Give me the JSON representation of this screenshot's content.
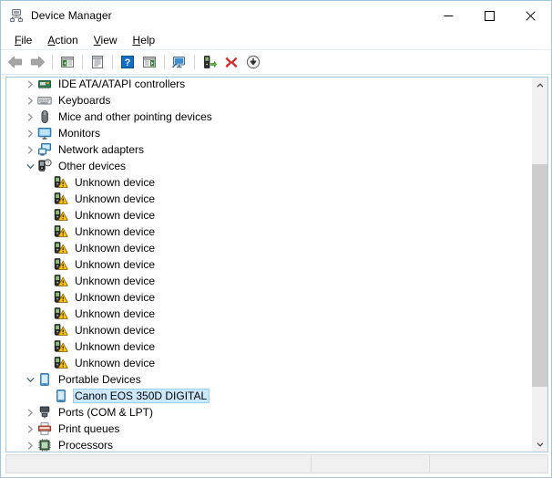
{
  "window": {
    "title": "Device Manager",
    "icon": "device-manager-icon"
  },
  "caption": {
    "minimize_label": "—",
    "maximize_label": "☐",
    "close_label": "✕"
  },
  "menubar": {
    "items": [
      {
        "label": "File",
        "accel": "F"
      },
      {
        "label": "Action",
        "accel": "A"
      },
      {
        "label": "View",
        "accel": "V"
      },
      {
        "label": "Help",
        "accel": "H"
      }
    ]
  },
  "toolbar": {
    "buttons": [
      {
        "name": "back-icon",
        "tooltip": "Back"
      },
      {
        "name": "forward-icon",
        "tooltip": "Forward"
      },
      {
        "name": "separator-1",
        "tooltip": ""
      },
      {
        "name": "show-hide-console-tree-icon",
        "tooltip": "Show/Hide Console Tree"
      },
      {
        "name": "separator-2",
        "tooltip": ""
      },
      {
        "name": "properties-icon",
        "tooltip": "Properties"
      },
      {
        "name": "separator-3",
        "tooltip": ""
      },
      {
        "name": "help-icon",
        "tooltip": "Help"
      },
      {
        "name": "show-hide-action-pane-icon",
        "tooltip": "Show/Hide Action Pane"
      },
      {
        "name": "separator-4",
        "tooltip": ""
      },
      {
        "name": "scan-for-hardware-changes-icon",
        "tooltip": "Scan for hardware changes"
      },
      {
        "name": "separator-5",
        "tooltip": ""
      },
      {
        "name": "update-driver-icon",
        "tooltip": "Update Driver Software"
      },
      {
        "name": "uninstall-device-icon",
        "tooltip": "Uninstall"
      },
      {
        "name": "disable-device-icon",
        "tooltip": "Disable"
      }
    ]
  },
  "tree": {
    "rows": [
      {
        "label": "IDE ATA/ATAPI controllers",
        "icon": "ide-controller-icon",
        "indent": 1,
        "twisty": "collapsed",
        "selected": false
      },
      {
        "label": "Keyboards",
        "icon": "keyboard-icon",
        "indent": 1,
        "twisty": "collapsed",
        "selected": false
      },
      {
        "label": "Mice and other pointing devices",
        "icon": "mouse-icon",
        "indent": 1,
        "twisty": "collapsed",
        "selected": false
      },
      {
        "label": "Monitors",
        "icon": "monitor-icon",
        "indent": 1,
        "twisty": "collapsed",
        "selected": false
      },
      {
        "label": "Network adapters",
        "icon": "network-adapter-icon",
        "indent": 1,
        "twisty": "collapsed",
        "selected": false
      },
      {
        "label": "Other devices",
        "icon": "other-devices-icon",
        "indent": 1,
        "twisty": "expanded",
        "selected": false
      },
      {
        "label": "Unknown device",
        "icon": "unknown-device-warning-icon",
        "indent": 2,
        "twisty": "none",
        "selected": false
      },
      {
        "label": "Unknown device",
        "icon": "unknown-device-warning-icon",
        "indent": 2,
        "twisty": "none",
        "selected": false
      },
      {
        "label": "Unknown device",
        "icon": "unknown-device-warning-icon",
        "indent": 2,
        "twisty": "none",
        "selected": false
      },
      {
        "label": "Unknown device",
        "icon": "unknown-device-warning-icon",
        "indent": 2,
        "twisty": "none",
        "selected": false
      },
      {
        "label": "Unknown device",
        "icon": "unknown-device-warning-icon",
        "indent": 2,
        "twisty": "none",
        "selected": false
      },
      {
        "label": "Unknown device",
        "icon": "unknown-device-warning-icon",
        "indent": 2,
        "twisty": "none",
        "selected": false
      },
      {
        "label": "Unknown device",
        "icon": "unknown-device-warning-icon",
        "indent": 2,
        "twisty": "none",
        "selected": false
      },
      {
        "label": "Unknown device",
        "icon": "unknown-device-warning-icon",
        "indent": 2,
        "twisty": "none",
        "selected": false
      },
      {
        "label": "Unknown device",
        "icon": "unknown-device-warning-icon",
        "indent": 2,
        "twisty": "none",
        "selected": false
      },
      {
        "label": "Unknown device",
        "icon": "unknown-device-warning-icon",
        "indent": 2,
        "twisty": "none",
        "selected": false
      },
      {
        "label": "Unknown device",
        "icon": "unknown-device-warning-icon",
        "indent": 2,
        "twisty": "none",
        "selected": false
      },
      {
        "label": "Unknown device",
        "icon": "unknown-device-warning-icon",
        "indent": 2,
        "twisty": "none",
        "selected": false
      },
      {
        "label": "Portable Devices",
        "icon": "portable-device-icon",
        "indent": 1,
        "twisty": "expanded",
        "selected": false
      },
      {
        "label": "Canon EOS 350D DIGITAL",
        "icon": "portable-device-icon",
        "indent": 2,
        "twisty": "none",
        "selected": true
      },
      {
        "label": "Ports (COM & LPT)",
        "icon": "ports-icon",
        "indent": 1,
        "twisty": "collapsed",
        "selected": false
      },
      {
        "label": "Print queues",
        "icon": "print-queue-icon",
        "indent": 1,
        "twisty": "collapsed",
        "selected": false
      },
      {
        "label": "Processors",
        "icon": "processor-icon",
        "indent": 1,
        "twisty": "collapsed",
        "selected": false
      }
    ]
  },
  "statusbar": {
    "main_text": "",
    "pane_2_text": "",
    "pane_3_text": ""
  },
  "colors": {
    "selection_fill": "#cce8ff",
    "selection_border": "#99d1ff",
    "window_border": "#9fc6dc",
    "warning_yellow": "#ffc20e",
    "uninstall_red": "#d42a2a",
    "update_green": "#4caf2a"
  }
}
